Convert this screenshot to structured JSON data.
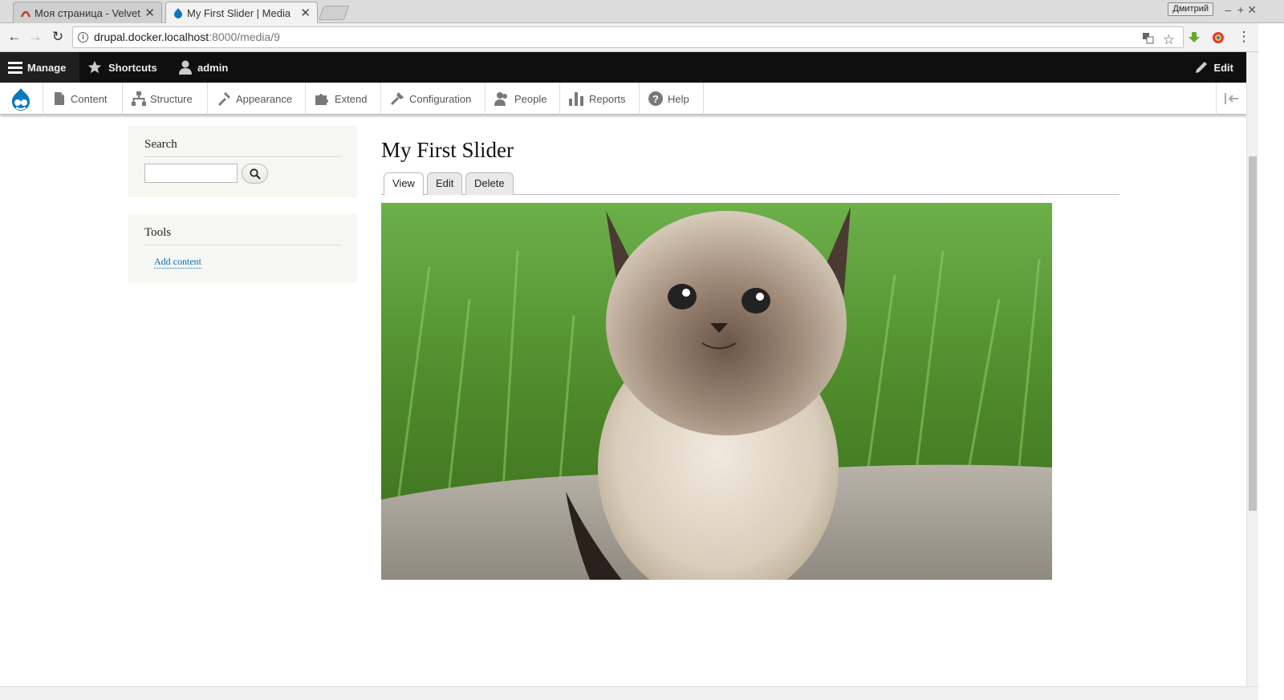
{
  "browser": {
    "tabs": [
      {
        "title": "Моя страница - Velvet"
      },
      {
        "title": "My First Slider | Media"
      }
    ],
    "profile_name": "Дмитрий",
    "url_host": "drupal.docker.localhost",
    "url_rest": ":8000/media/9"
  },
  "toolbar": {
    "manage": "Manage",
    "shortcuts": "Shortcuts",
    "user": "admin",
    "edit": "Edit"
  },
  "admin_menu": [
    {
      "label": "Content"
    },
    {
      "label": "Structure"
    },
    {
      "label": "Appearance"
    },
    {
      "label": "Extend"
    },
    {
      "label": "Configuration"
    },
    {
      "label": "People"
    },
    {
      "label": "Reports"
    },
    {
      "label": "Help"
    }
  ],
  "sidebar": {
    "search_title": "Search",
    "tools_title": "Tools",
    "add_content": "Add content"
  },
  "page": {
    "title": "My First Slider",
    "tabs": [
      {
        "label": "View"
      },
      {
        "label": "Edit"
      },
      {
        "label": "Delete"
      }
    ]
  },
  "colors": {
    "drupal_blue": "#0678be",
    "link": "#0071b3",
    "toolbar_bg": "#0f0f0f"
  }
}
